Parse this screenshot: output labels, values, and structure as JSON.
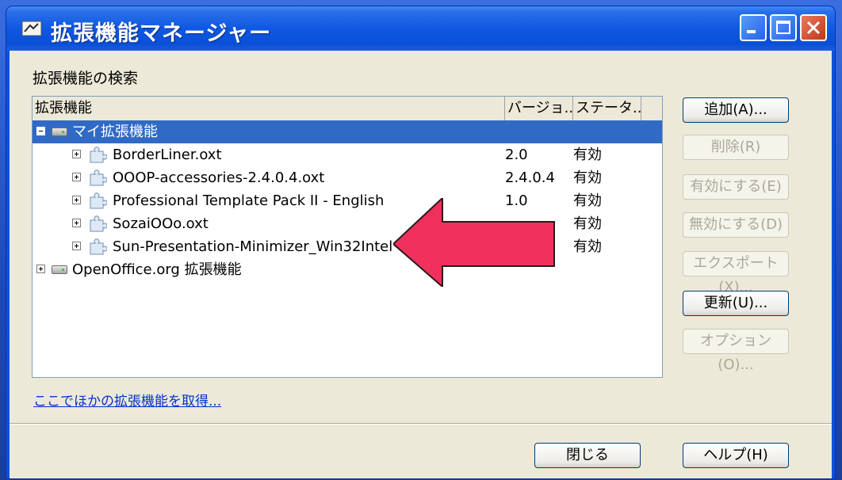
{
  "window": {
    "title": "拡張機能マネージャー"
  },
  "search_title": "拡張機能の検索",
  "columns": {
    "name": "拡張機能",
    "version": "バージョ...",
    "status": "ステータ..."
  },
  "tree": {
    "group_my": "マイ拡張機能",
    "group_oo": "OpenOffice.org 拡張機能",
    "items": [
      {
        "name": "BorderLiner.oxt",
        "version": "2.0",
        "status": "有効"
      },
      {
        "name": "OOOP-accessories-2.4.0.4.oxt",
        "version": "2.4.0.4",
        "status": "有効"
      },
      {
        "name": "Professional Template Pack II - English",
        "version": "1.0",
        "status": "有効"
      },
      {
        "name": "SozaiOOo.oxt",
        "version": "",
        "status": "有効"
      },
      {
        "name": "Sun-Presentation-Minimizer_Win32Intel",
        "version": "",
        "status": "有効"
      }
    ]
  },
  "buttons": {
    "add": "追加(A)...",
    "remove": "削除(R)",
    "enable": "有効にする(E)",
    "disable": "無効にする(D)",
    "export": "エクスポート(X)...",
    "update": "更新(U)...",
    "options": "オプション(O)...",
    "close": "閉じる",
    "help": "ヘルプ(H)"
  },
  "link_get_more": "ここでほかの拡張機能を取得...",
  "colors": {
    "titlebar": "#0a52dd",
    "selection": "#316ac5",
    "annotation_arrow": "#f0305c"
  },
  "icons": {
    "app": "app-icon",
    "extension": "puzzle-icon",
    "group": "drive-icon"
  }
}
